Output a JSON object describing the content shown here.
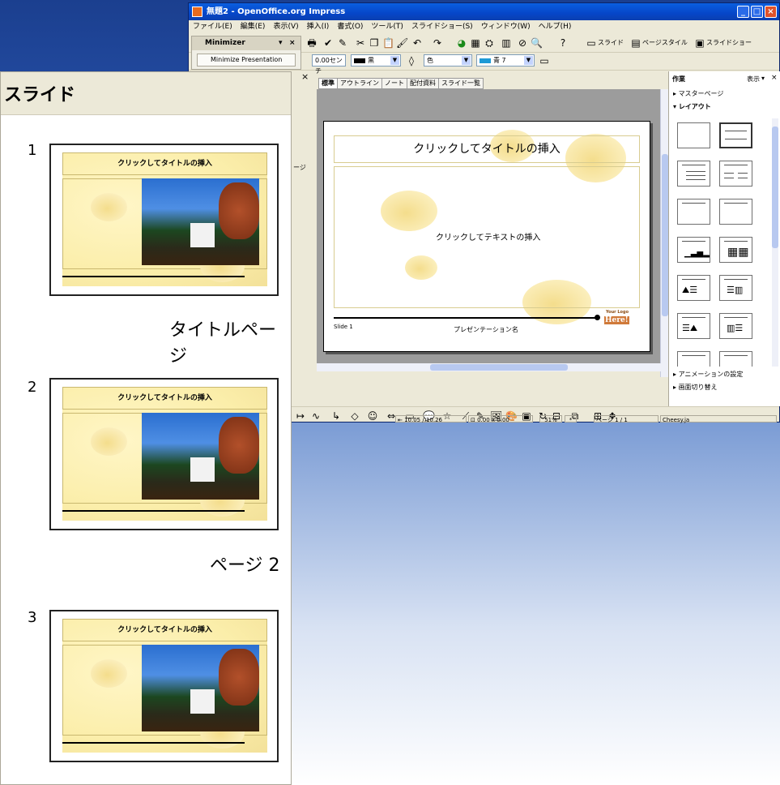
{
  "window": {
    "title": "無題2 - OpenOffice.org Impress",
    "menu": [
      "ファイル(E)",
      "編集(E)",
      "表示(V)",
      "挿入(I)",
      "書式(O)",
      "ツール(T)",
      "スライドショー(S)",
      "ウィンドウ(W)",
      "ヘルプ(H)"
    ]
  },
  "toolbar": {
    "slide_btn": "スライド",
    "page_style_btn": "ページスタイル",
    "slideshow_btn": "スライドショー",
    "line_width": "0.00センチ",
    "line_color": "黒",
    "fill_type": "色",
    "fill_color": "青 7"
  },
  "minimizer": {
    "title": "Minimizer",
    "button": "Minimize Presentation"
  },
  "view_tabs": [
    "標準",
    "アウトライン",
    "ノート",
    "配付資料",
    "スライド一覧"
  ],
  "slide": {
    "title_placeholder": "クリックしてタイトルの挿入",
    "text_placeholder": "クリックしてテキストの挿入",
    "footer_left": "Slide 1",
    "footer_center": "プレゼンテーション名",
    "logo_line1": "Your Logo",
    "logo_line2": "Here!"
  },
  "task_pane": {
    "title": "作業",
    "view_menu": "表示",
    "sections": [
      "マスターページ",
      "レイアウト",
      "アニメーションの設定",
      "画面切り替え"
    ]
  },
  "status": {
    "position": "10.05 / 10.26",
    "size": "0.00 x 0.00",
    "zoom": "51%",
    "page": "ページ 1 / 1",
    "style": "Cheesy.ja"
  },
  "slides_panel": {
    "title": "スライド",
    "partial_label": "ージ",
    "items": [
      {
        "number": "1",
        "label": "タイトルページ",
        "thumb_title": "クリックしてタイトルの挿入"
      },
      {
        "number": "2",
        "label": "ページ 2",
        "thumb_title": "クリックしてタイトルの挿入"
      },
      {
        "number": "3",
        "label": "",
        "thumb_title": "クリックしてタイトルの挿入"
      }
    ]
  },
  "colors": {
    "titlebar": "#0a5fe0",
    "slide_yellow": "#fbeeaa",
    "background_top": "#1b3f8f"
  }
}
